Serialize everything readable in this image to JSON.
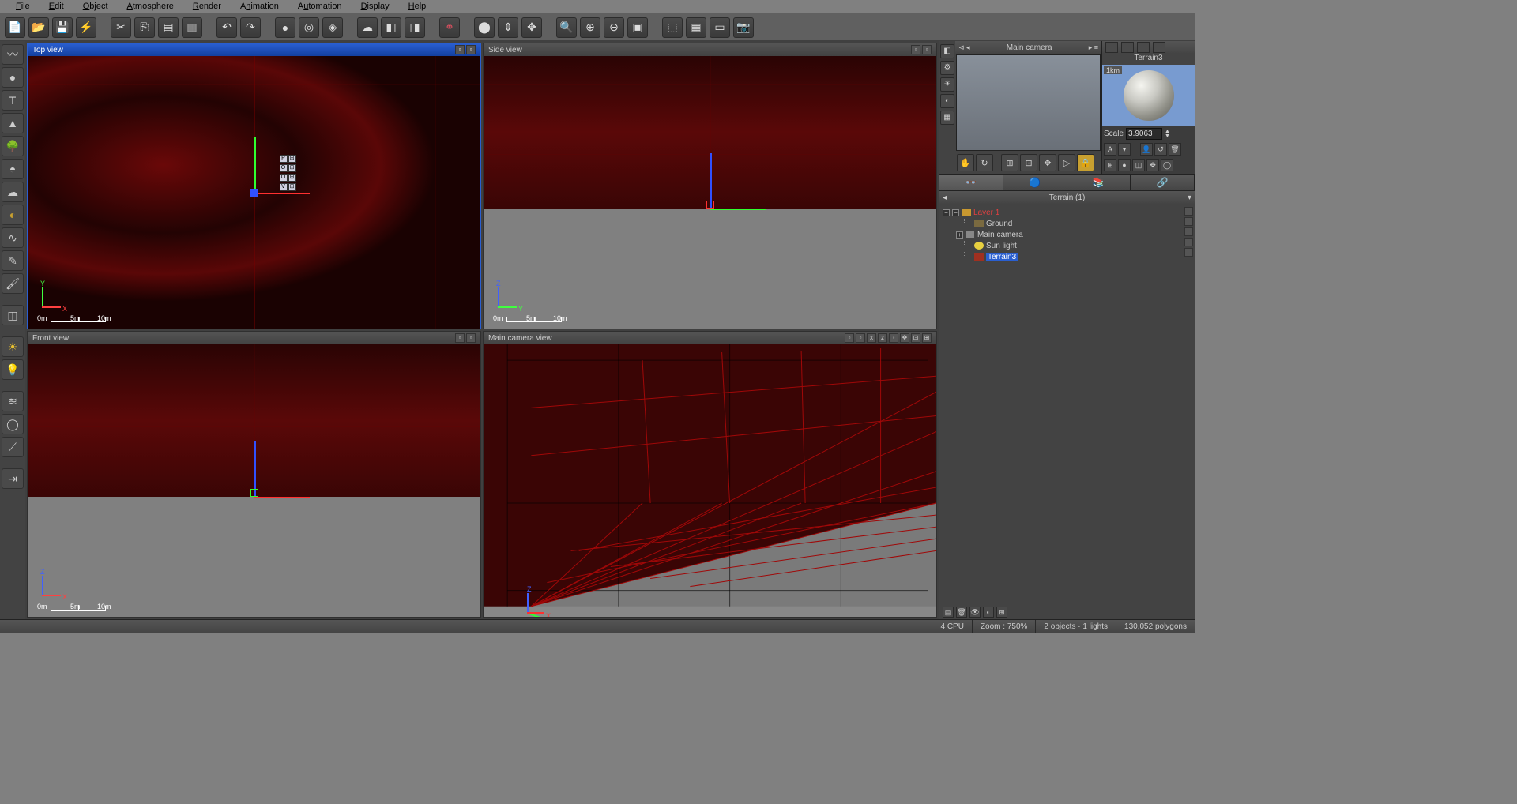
{
  "menu": {
    "file": "File",
    "edit": "Edit",
    "object": "Object",
    "atmosphere": "Atmosphere",
    "render": "Render",
    "animation": "Animation",
    "automation": "Automation",
    "display": "Display",
    "help": "Help"
  },
  "viewports": {
    "top": {
      "title": "Top view",
      "axisA": "Y",
      "axisB": "X",
      "scale0": "0m",
      "scale1": "5m",
      "scale2": "10m"
    },
    "side": {
      "title": "Side view",
      "axisA": "Z",
      "axisB": "Y",
      "scale0": "0m",
      "scale1": "5m",
      "scale2": "10m"
    },
    "front": {
      "title": "Front view",
      "axisA": "Z",
      "axisB": "X",
      "scale0": "0m",
      "scale1": "5m",
      "scale2": "10m"
    },
    "camera": {
      "title": "Main camera view"
    }
  },
  "camera_label": "Main camera",
  "object": {
    "name": "Terrain3",
    "scale_label": "Scale",
    "scale_value": "3.9063",
    "km": "1km",
    "a_btn": "A"
  },
  "terrain_panel_title": "Terrain (1)",
  "tree": {
    "layer": "Layer 1",
    "ground": "Ground",
    "camera": "Main camera",
    "sun": "Sun light",
    "terrain": "Terrain3"
  },
  "status": {
    "cpu": "4 CPU",
    "zoom": "Zoom : 750%",
    "objects": "2 objects · 1 lights",
    "polys": "130,052 polygons"
  }
}
